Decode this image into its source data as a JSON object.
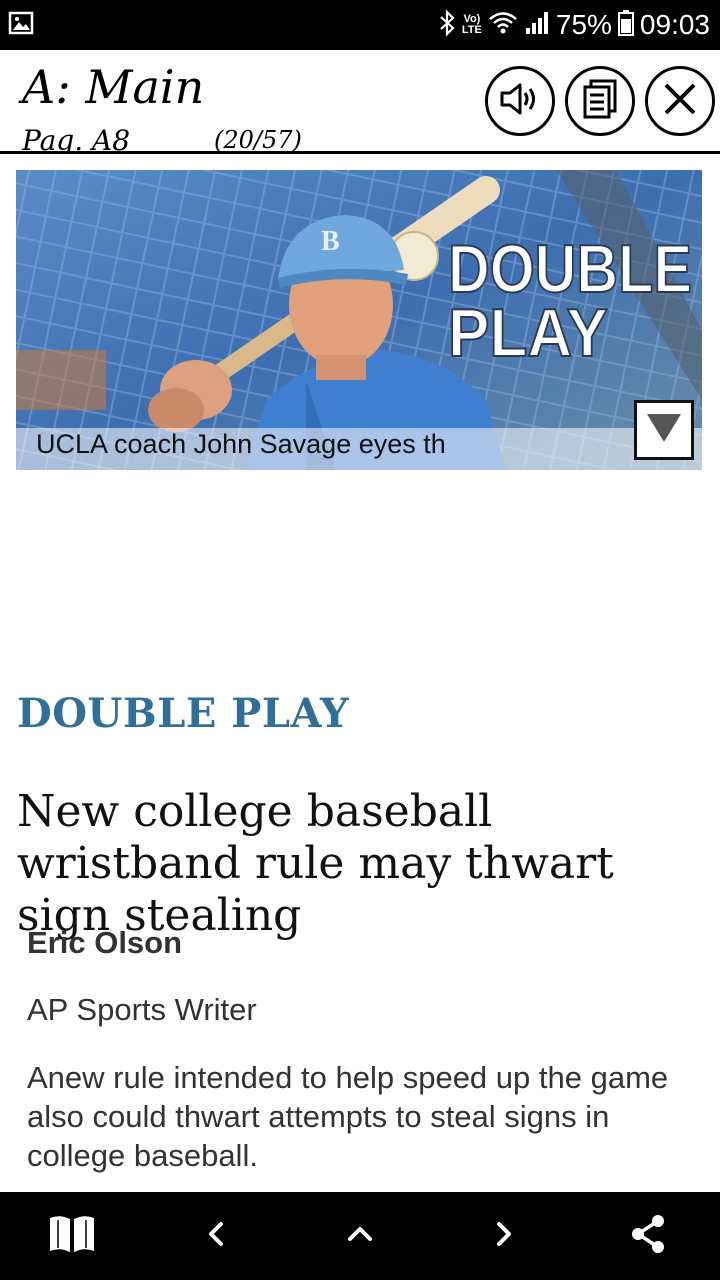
{
  "status_bar": {
    "battery": "75%",
    "time": "09:03",
    "network_badge_line1": "Vo)",
    "network_badge_line2": "LTE"
  },
  "header": {
    "section_title": "A: Main",
    "page_label": "Pag. A8",
    "page_count": "(20/57)",
    "buttons": [
      "speaker-icon",
      "article-list-icon",
      "close-icon"
    ]
  },
  "hero": {
    "overlay_headline_line1": "DOUBLE",
    "overlay_headline_line2": "PLAY",
    "cap_letter": "B",
    "caption": "UCLA coach John Savage eyes th"
  },
  "article": {
    "kicker": "DOUBLE PLAY",
    "headline": "New college baseball wristband rule may thwart sign stealing",
    "author": "Eric Olson",
    "author_role": "AP Sports Writer",
    "body": "Anew rule intended to help speed up the game also could thwart attempts to steal signs in college baseball."
  },
  "bottom_nav": {
    "items": [
      "reader-icon",
      "previous-icon",
      "up-icon",
      "next-icon",
      "share-icon"
    ]
  },
  "colors": {
    "kicker": "#2f6f9a",
    "bars": "#000000"
  }
}
